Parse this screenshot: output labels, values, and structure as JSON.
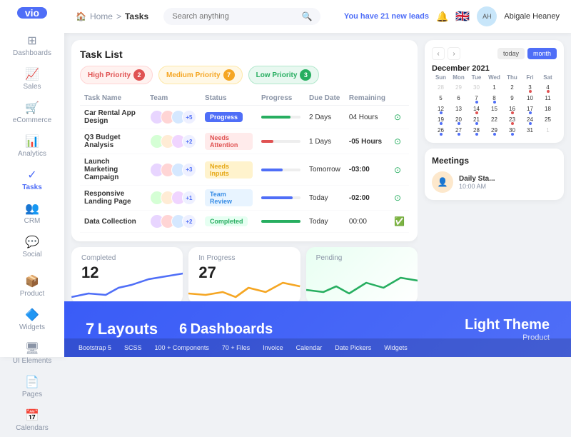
{
  "sidebar": {
    "logo": "vio",
    "items": [
      {
        "label": "Dashboards",
        "icon": "⊞",
        "active": false
      },
      {
        "label": "Sales",
        "icon": "📈",
        "active": false
      },
      {
        "label": "eCommerce",
        "icon": "🛒",
        "active": false
      },
      {
        "label": "Analytics",
        "icon": "📊",
        "active": false
      },
      {
        "label": "Tasks",
        "icon": "✓",
        "active": true
      },
      {
        "label": "CRM",
        "icon": "👥",
        "active": false
      },
      {
        "label": "Social",
        "icon": "💬",
        "active": false
      },
      {
        "label": "Product",
        "icon": "📦",
        "active": false
      },
      {
        "label": "Widgets",
        "icon": "🔷",
        "active": false
      },
      {
        "label": "UI Elements",
        "icon": "🖥",
        "active": false
      },
      {
        "label": "Pages",
        "icon": "📄",
        "active": false
      },
      {
        "label": "Calendars",
        "icon": "📅",
        "active": false
      }
    ]
  },
  "header": {
    "breadcrumb": {
      "home": "Home",
      "separator": ">",
      "current": "Tasks"
    },
    "search_placeholder": "Search anything",
    "leads_text": "You have",
    "leads_count": "21",
    "leads_suffix": "new leads",
    "user_name": "Abigale Heaney"
  },
  "task_list": {
    "title": "Task List",
    "priority_tabs": [
      {
        "label": "High Priority",
        "count": "2",
        "type": "high"
      },
      {
        "label": "Medium Priority",
        "count": "7",
        "type": "medium"
      },
      {
        "label": "Low Priority",
        "count": "3",
        "type": "low"
      }
    ],
    "columns": [
      "Task Name",
      "Team",
      "Status",
      "Progress",
      "Due Date",
      "Remaining"
    ],
    "rows": [
      {
        "name": "Car Rental App Design",
        "team_count": "+5",
        "status": "Progress",
        "status_type": "progress",
        "progress": 75,
        "progress_color": "#27ae60",
        "due": "2 Days",
        "due_type": "normal",
        "remaining": "04 Hours",
        "remaining_type": "normal"
      },
      {
        "name": "Q3 Budget Analysis",
        "team_count": "+2",
        "status": "Needs Attention",
        "status_type": "needs-attention",
        "progress": 30,
        "progress_color": "#e05252",
        "due": "1 Days",
        "due_type": "normal",
        "remaining": "-05 Hours",
        "remaining_type": "red"
      },
      {
        "name": "Launch Marketing Campaign",
        "team_count": "+3",
        "status": "Needs Inputs",
        "status_type": "needs-inputs",
        "progress": 55,
        "progress_color": "#4f6ef7",
        "due": "Tomorrow",
        "due_type": "normal",
        "remaining": "-03:00",
        "remaining_type": "red"
      },
      {
        "name": "Responsive Landing Page",
        "team_count": "+1",
        "status": "Team Review",
        "status_type": "team-review",
        "progress": 80,
        "progress_color": "#4f6ef7",
        "due": "Today",
        "due_type": "normal",
        "remaining": "-02:00",
        "remaining_type": "red"
      },
      {
        "name": "Data Collection",
        "team_count": "+2",
        "status": "Completed",
        "status_type": "completed",
        "progress": 100,
        "progress_color": "#27ae60",
        "due": "Today",
        "due_type": "normal",
        "remaining": "00:00",
        "remaining_type": "normal"
      }
    ]
  },
  "stats": [
    {
      "label": "Completed",
      "value": "12",
      "color": "#4f6ef7"
    },
    {
      "label": "In Progress",
      "value": "27",
      "color": "#f5a623"
    },
    {
      "label": "Pending",
      "value": "",
      "color": "#27ae60"
    }
  ],
  "calendar": {
    "month": "December 2021",
    "weekdays": [
      "Sun",
      "Mon",
      "Tue",
      "Wed",
      "Thu",
      "Fri",
      "Sat"
    ],
    "nav_prev": "‹",
    "nav_next": "›",
    "btn_today": "today",
    "btn_month": "month"
  },
  "meetings": {
    "title": "Meetings",
    "item": {
      "name": "Daily Sta...",
      "time": "10:00 AM"
    }
  },
  "overlay": {
    "layouts_count": "7",
    "layouts_label": "Layouts",
    "dashboards_count": "6",
    "dashboards_label": "Dashboards",
    "theme": "Light Theme",
    "product": "Product",
    "tags": [
      "Bootstrap 5",
      "SCSS",
      "100 + Components",
      "70 + Files",
      "Invoice",
      "Calendar",
      "Date Pickers",
      "Widgets"
    ]
  }
}
